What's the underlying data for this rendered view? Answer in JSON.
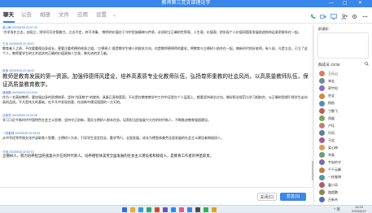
{
  "window": {
    "title": "教师第三党支部理论学",
    "controls": [
      "—",
      "▢",
      "✕"
    ]
  },
  "tabs": [
    {
      "label": "聊天",
      "active": true
    },
    {
      "label": "公告",
      "active": false
    },
    {
      "label": "相册",
      "active": false
    },
    {
      "label": "文件",
      "active": false
    },
    {
      "label": "应用",
      "active": false
    },
    {
      "label": "设置",
      "active": false
    }
  ],
  "more_tabs": "⌄",
  "messages": [
    {
      "meta": "梁心梅 2023/5/26 22:07:42",
      "style": "s",
      "text": "\"为学须先立志，志既立，则学问可次第着力。立志不定，终不济事。\"教师的价值在于守护民族精神与传承，必须树立正确的世界观、人生观、价值观、把实现个人价值同国家发展前途和命运紧密联系在一起。"
    },
    {
      "meta": "王毛 2023/5/26 22:16:01",
      "style": "s",
      "text": "教育者人之责，不仅要重视自身成长，更要注重师德的修身之道。\"立德树人\"既是教学生做人的根本方向，也是教师德律师的要求。将教育与立德树人结合在一起，做新时代的好老师。有人说，凡是立志，已立了这个人，教师要学生树立并追求的正确的价值观和人生观，做先进的学习者。"
    },
    {
      "meta": "徐宝 2023/5/26 22:18:43",
      "style": "l",
      "text": "教师是教育发展的第一资源。加强师德师风建设，培养高素质专业化教师队伍，弘扬尊师重教的社会风尚，以高质量教师队伍，保证高质量教育教学。"
    },
    {
      "meta": "路超鹏 2023/5/26 22:19:04",
      "style": "s",
      "text": "作为一名高校教师，要加强自身的思想修养、坚持\"为国育才\"的使命，具备正直和宽容。不论是在教育教学中工作中还是在个人层面上，都要坚持政治方向，做好职业规范与学习相结合，以正确的思想引领学生走向高尚品质。平凡是伟大的基础，在平凡中发现创意，在创新中建设祖国的一方天地。"
    },
    {
      "meta": "吕新杰 2023/5/26 22:20:35",
      "style": "s",
      "text": "学习习近平新时代中国特色社会主义思想，坚持守正创新，落实立德树人根本任务。培养担当民族复兴大任的时代新人，不断推进教育强国建设。"
    },
    {
      "meta": "一枝春博 2023/5/26 22:25:54",
      "style": "s",
      "text": "从中华优秀传统文化中汲取育人智慧，立德树人为本，引导学生坚定信念，勤学笃行，全面发展，成长为德智体美劳全面发展的社会主义建设者和接班人。"
    },
    {
      "meta": "马宝 2023/5/26 22:52:01",
      "style": "m",
      "text": "立德树人，努力培养担当民族复兴大任的时代新人，培养德智体美劳全面发展的社会主义建设者和接班人，是教育工作者的神圣职责。"
    }
  ],
  "send_bar": {
    "close_label": "关闭(C)",
    "send_label": "发送(S)"
  },
  "sidebar": {
    "notice_title": "群通知",
    "members_title": "群成员",
    "members_count": "23/38",
    "members": [
      {
        "name": "王乐山",
        "color": "#e07a5f"
      },
      {
        "name": "林宏",
        "color": "#6b8e9e"
      },
      {
        "name": "郭宇阳",
        "color": "#8e6bbd"
      },
      {
        "name": "徐宝",
        "color": "#d08b3b"
      },
      {
        "name": "杨航",
        "color": "#4a90c2"
      },
      {
        "name": "丁鹏飞",
        "color": "#c45a5a"
      },
      {
        "name": "周媛",
        "color": "#7aa35c"
      },
      {
        "name": "卢珏",
        "color": "#b5876b"
      },
      {
        "name": "丹凤",
        "color": "#5c7fa3"
      },
      {
        "name": "马宝",
        "color": "#a35c8e"
      },
      {
        "name": "梁心梅",
        "color": "#d4a24c"
      },
      {
        "name": "李泰",
        "color": "#6f9b7c"
      },
      {
        "name": "宇宙的守",
        "color": "#7c6fb0"
      },
      {
        "name": "千千云峰",
        "color": "#c27c4a"
      },
      {
        "name": "一枝春博",
        "color": "#4e9aa8"
      },
      {
        "name": "童小凤",
        "color": "#b05c6f"
      },
      {
        "name": "路超鹏",
        "color": "#8a8a4a"
      },
      {
        "name": "吕新杰",
        "color": "#5a6fb0"
      }
    ]
  },
  "taskbar": {
    "time": "10:24",
    "date": "2023/5/27",
    "sys": "^ 英",
    "icon_colors": [
      "#2b6fd6",
      "#f0a830",
      "#3a9ad9",
      "#2aa876",
      "#d6472b",
      "#6a4fc4",
      "#1e90ff",
      "#e35a8a",
      "#3a86ea",
      "#4a4a4a",
      "#2cb34a",
      "#e0a020"
    ]
  }
}
